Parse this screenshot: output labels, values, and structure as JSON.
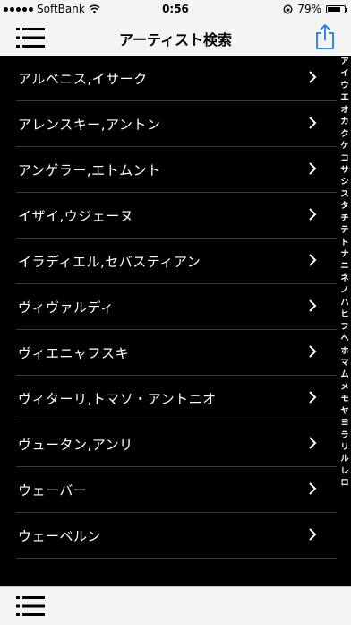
{
  "status_bar": {
    "carrier": "SoftBank",
    "time": "0:56",
    "battery": "79%",
    "battery_level": 0.79,
    "icons": [
      "signal-dots-icon",
      "wifi-icon",
      "rotation-lock-icon",
      "battery-icon"
    ]
  },
  "nav": {
    "title": "アーティスト検索",
    "left_icon": "menu-list-icon",
    "right_icon": "share-icon"
  },
  "artists": [
    "アルベニス,イサーク",
    "アレンスキー,アントン",
    "アンゲラー,エトムント",
    "イザイ,ウジェーヌ",
    "イラディエル,セバスティアン",
    "ヴィヴァルディ",
    "ヴィエニャフスキ",
    "ヴィターリ,トマソ・アントニオ",
    "ヴュータン,アンリ",
    "ウェーバー",
    "ウェーベルン"
  ],
  "index_letters": [
    "ア",
    "イ",
    "ウ",
    "エ",
    "オ",
    "カ",
    "ク",
    "ケ",
    "コ",
    "サ",
    "シ",
    "ス",
    "タ",
    "チ",
    "テ",
    "ト",
    "ナ",
    "ニ",
    "ネ",
    "ノ",
    "ハ",
    "ヒ",
    "フ",
    "ヘ",
    "ホ",
    "マ",
    "ム",
    "メ",
    "モ",
    "ヤ",
    "ヨ",
    "ラ",
    "リ",
    "ル",
    "レ",
    "ロ"
  ],
  "toolbar": {
    "icon": "menu-list-icon"
  }
}
